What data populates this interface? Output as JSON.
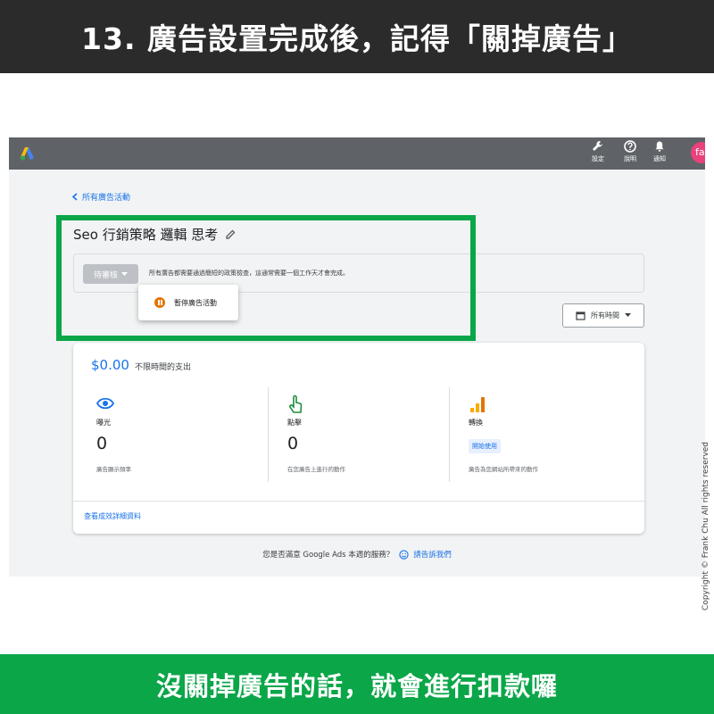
{
  "title_bar": {
    "text": "13. 廣告設置完成後，記得「關掉廣告」"
  },
  "ads_ui": {
    "topbar": {
      "settings_label": "設定",
      "help_label": "說明",
      "notifications_label": "通知",
      "avatar_text": "fa"
    },
    "back_link": "所有廣告活動",
    "campaign_name": "Seo 行銷策略 邏輯 思考",
    "status": {
      "button_label": "待審核",
      "message": "所有廣告都需要通過簡短的政策檢查，這通常需要一個工作天才會完成。"
    },
    "menu": {
      "pause_label": "暫停廣告活動"
    },
    "date_range": "所有時間",
    "spend": {
      "amount": "$0.00",
      "label": "不限時間的支出"
    },
    "metrics": [
      {
        "label": "曝光",
        "value": "0",
        "desc": "廣告顯示頻率",
        "icon": "eye-icon"
      },
      {
        "label": "點擊",
        "value": "0",
        "desc": "在您廣告上進行的動作",
        "icon": "click-icon"
      },
      {
        "label": "轉換",
        "desc": "廣告為您網站所帶來的動作",
        "button": "開始使用",
        "icon": "bar-chart-icon"
      }
    ],
    "details_link": "查看成效詳細資料",
    "survey": {
      "question": "您是否滿意 Google Ads 本週的服務？",
      "link": "請告訴我們"
    }
  },
  "copyright": "Copyright © Frank Chu All rights reserved",
  "bottom_bar": {
    "text": "沒關掉廣告的話，就會進行扣款囉"
  },
  "colors": {
    "title_bg": "#2b2b2b",
    "accent_green": "#0aa648",
    "link_blue": "#1a73e8",
    "pause_orange": "#e37400"
  }
}
